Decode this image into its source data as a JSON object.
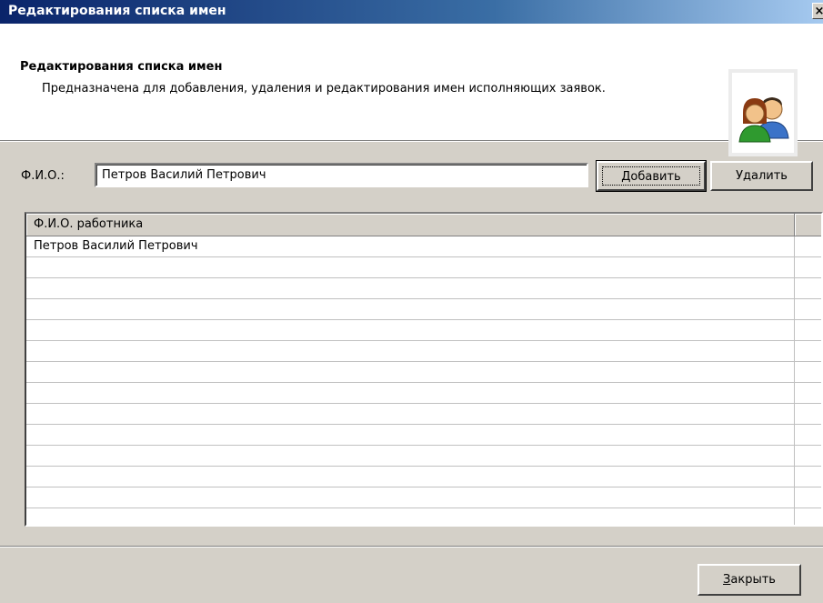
{
  "window": {
    "title": "Редактирования списка имен",
    "close_glyph": "×"
  },
  "header": {
    "title": "Редактирования списка имен",
    "description": "Предназначена для добавления, удаления и редактирования имен исполняющих заявок.",
    "icon": "users-icon"
  },
  "form": {
    "fio_label": "Ф.И.О.:",
    "fio_value": "Петров Василий Петрович",
    "add_label": "Добавить",
    "delete_label": "Удалить"
  },
  "table": {
    "column_header": "Ф.И.О. работника",
    "rows": [
      "Петров Василий Петрович",
      "",
      "",
      "",
      "",
      "",
      "",
      "",
      "",
      "",
      "",
      "",
      "",
      ""
    ]
  },
  "footer": {
    "close_label_underlined": "З",
    "close_label_rest": "акрыть"
  },
  "colors": {
    "title_gradient_start": "#0a246a",
    "title_gradient_end": "#a6caf0",
    "face": "#d4d0c8",
    "icon_green": "#2f9a2f",
    "icon_blue": "#3a72c8"
  }
}
